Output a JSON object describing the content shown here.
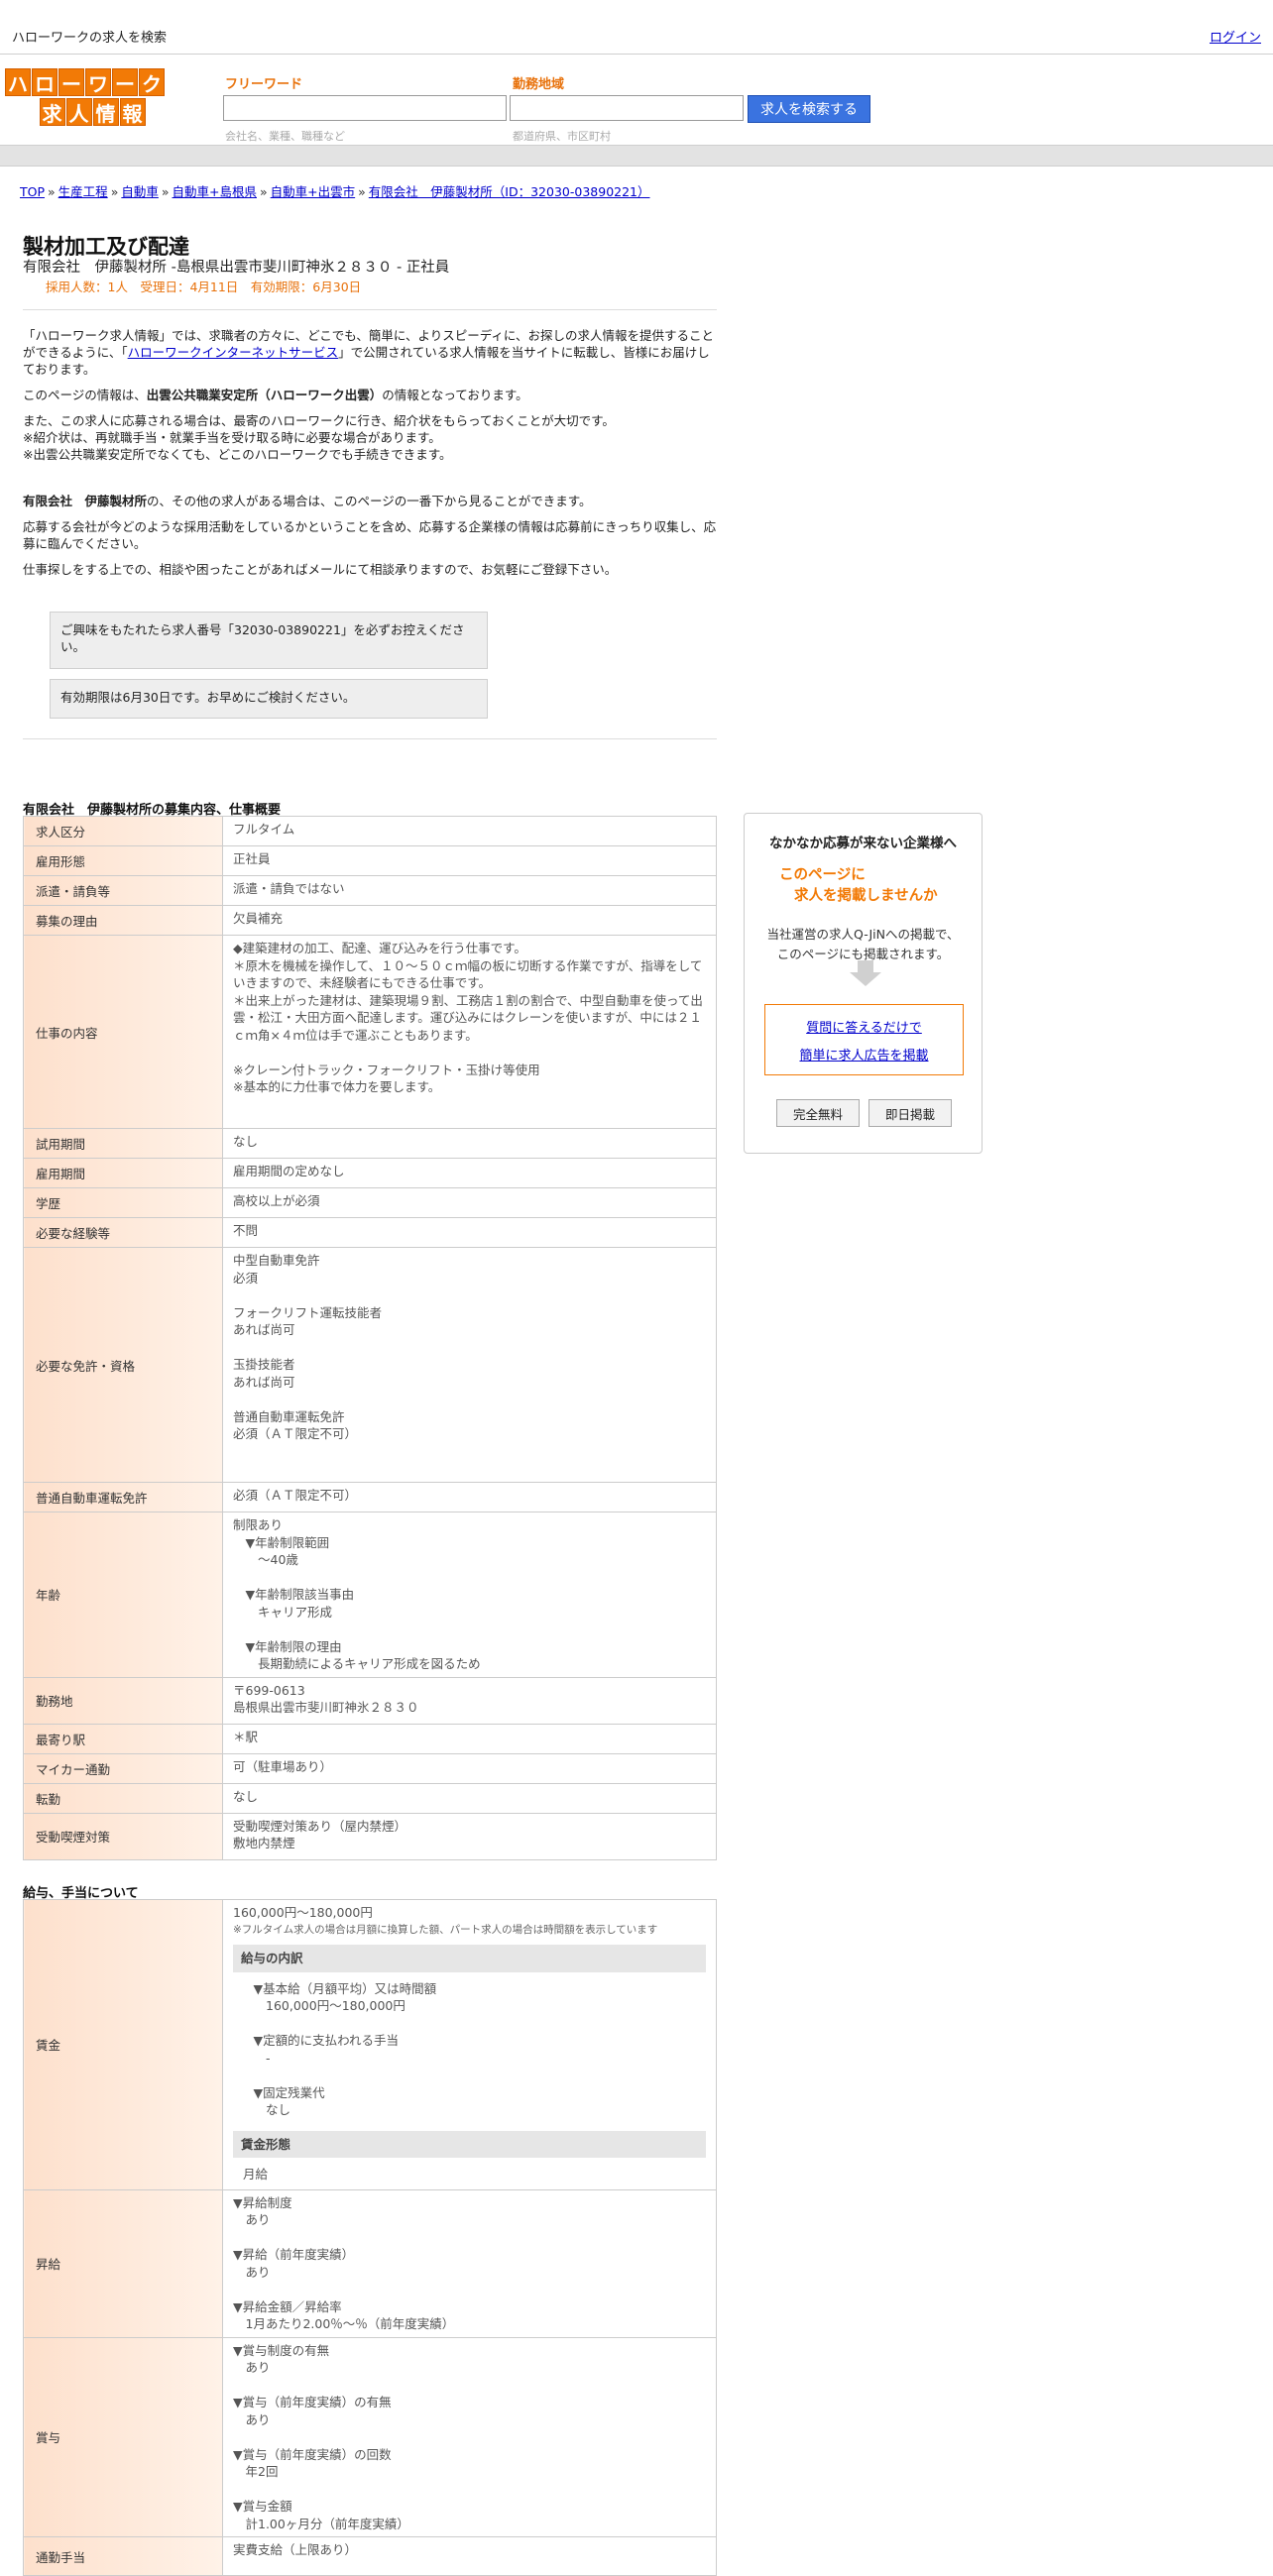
{
  "header": {
    "site_title": "ハローワークの求人を検索",
    "login": "ログイン",
    "logo": {
      "row1": [
        "ハ",
        "ロ",
        "ー",
        "ワ",
        "ー",
        "ク"
      ],
      "row2": [
        "求",
        "人",
        "情",
        "報"
      ]
    }
  },
  "search": {
    "freeword_label": "フリーワード",
    "freeword_value": "",
    "freeword_hint": "会社名、業種、職種など",
    "area_label": "勤務地域",
    "area_value": "",
    "area_hint": "都道府県、市区町村",
    "button": "求人を検索する"
  },
  "breadcrumb": [
    "TOP",
    "生産工程",
    "自動車",
    "自動車+島根県",
    "自動車+出雲市",
    "有限会社　伊藤製材所（ID：32030-03890221）"
  ],
  "job": {
    "title": "製材加工及び配達",
    "subtitle": "有限会社　伊藤製材所 -島根県出雲市斐川町神氷２８３０ - 正社員",
    "meta": "採用人数：1人　受理日：4月11日　有効期限：6月30日"
  },
  "intro": {
    "p1_a": "「ハローワーク求人情報」では、求職者の方々に、どこでも、簡単に、よりスピーディに、お探しの求人情報を提供することができるように、「",
    "p1_link": "ハローワークインターネットサービス",
    "p1_b": "」で公開されている求人情報を当サイトに転載し、皆様にお届けしております。",
    "p2_a": "このページの情報は、",
    "p2_bold": "出雲公共職業安定所（ハローワーク出雲）",
    "p2_b": "の情報となっております。",
    "p3": "また、この求人に応募される場合は、最寄のハローワークに行き、紹介状をもらっておくことが大切です。",
    "p4": "※紹介状は、再就職手当・就業手当を受け取る時に必要な場合があります。",
    "p5": "※出雲公共職業安定所でなくても、どこのハローワークでも手続きできます。",
    "p6_bold": "有限会社　伊藤製材所",
    "p6_b": "の、その他の求人がある場合は、このページの一番下から見ることができます。",
    "p7": "応募する会社が今どのような採用活動をしているかということを含め、応募する企業様の情報は応募前にきっちり収集し、応募に臨んでください。",
    "p8": "仕事探しをする上での、相談や困ったことがあればメールにて相談承りますので、お気軽にご登録下さい。"
  },
  "notices": [
    "ご興味をもたれたら求人番号「32030-03890221」を必ずお控えください。",
    "有効期限は6月30日です。お早めにご検討ください。"
  ],
  "overview": {
    "title": "有限会社　伊藤製材所の募集内容、仕事概要",
    "rows": [
      {
        "label": "求人区分",
        "value": "フルタイム"
      },
      {
        "label": "雇用形態",
        "value": "正社員"
      },
      {
        "label": "派遣・請負等",
        "value": "派遣・請負ではない"
      },
      {
        "label": "募集の理由",
        "value": "欠員補充"
      },
      {
        "label": "仕事の内容",
        "value": "◆建築建材の加工、配達、運び込みを行う仕事です。\n＊原木を機械を操作して、１０～５０ｃｍ幅の板に切断する作業ですが、指導をしていきますので、未経験者にもできる仕事です。\n＊出来上がった建材は、建築現場９割、工務店１割の割合で、中型自動車を使って出雲・松江・大田方面へ配達します。運び込みにはクレーンを使いますが、中には２１ｃｍ角×４ｍ位は手で運ぶこともあります。\n\n※クレーン付トラック・フォークリフト・玉掛け等使用\n※基本的に力仕事で体力を要します。"
      },
      {
        "label": "試用期間",
        "value": "なし"
      },
      {
        "label": "雇用期間",
        "value": "雇用期間の定めなし"
      },
      {
        "label": "学歴",
        "value": "高校以上が必須"
      },
      {
        "label": "必要な経験等",
        "value": "不問"
      },
      {
        "label": "必要な免許・資格",
        "value": "中型自動車免許\n必須\n\nフォークリフト運転技能者\nあれば尚可\n\n玉掛技能者\nあれば尚可\n\n普通自動車運転免許\n必須（ＡＴ限定不可）"
      },
      {
        "label": "普通自動車運転免許",
        "value": "必須（ＡＴ限定不可）"
      },
      {
        "label": "年齢",
        "value": "制限あり\n　▼年齢制限範囲\n　　〜40歳\n\n　▼年齢制限該当事由\n　　キャリア形成\n\n　▼年齢制限の理由\n　　長期勤続によるキャリア形成を図るため"
      },
      {
        "label": "勤務地",
        "value": "〒699-0613\n島根県出雲市斐川町神氷２８３０"
      },
      {
        "label": "最寄り駅",
        "value": "＊駅"
      },
      {
        "label": "マイカー通勤",
        "value": "可（駐車場あり）"
      },
      {
        "label": "転勤",
        "value": "なし"
      },
      {
        "label": "受動喫煙対策",
        "value": "受動喫煙対策あり（屋内禁煙）\n敷地内禁煙"
      }
    ]
  },
  "salary": {
    "title": "給与、手当について",
    "wage_label": "賃金",
    "wage_range": "160,000円〜180,000円",
    "wage_note": "※フルタイム求人の場合は月額に換算した額、パート求人の場合は時間額を表示しています",
    "breakdown_title": "給与の内訳",
    "breakdown": "　▼基本給（月額平均）又は時間額\n　　160,000円〜180,000円\n\n　▼定額的に支払われる手当\n　　-\n\n　▼固定残業代\n　　なし",
    "form_title": "賃金形態",
    "form_value": "月給",
    "raise_label": "昇給",
    "raise_value": "▼昇給制度\n　あり\n\n▼昇給（前年度実績）\n　あり\n\n▼昇給金額／昇給率\n　1月あたり2.00％〜％（前年度実績）",
    "bonus_label": "賞与",
    "bonus_value": "▼賞与制度の有無\n　あり\n\n▼賞与（前年度実績）の有無\n　あり\n\n▼賞与（前年度実績）の回数\n　年2回\n\n▼賞与金額\n　計1.00ヶ月分（前年度実績）",
    "commute_label": "通勤手当",
    "commute_value": "実費支給（上限あり）"
  },
  "ad": {
    "heading": "なかなか応募が来ない企業様へ",
    "orange1": "このページに",
    "orange2": "求人を掲載しませんか",
    "desc1": "当社運営の求人Q-JiNへの掲載で、",
    "desc2": "このページにも掲載されます。",
    "link1": "質問に答えるだけで",
    "link2": "簡単に求人広告を掲載",
    "btn_free": "完全無料",
    "btn_same_day": "即日掲載"
  }
}
